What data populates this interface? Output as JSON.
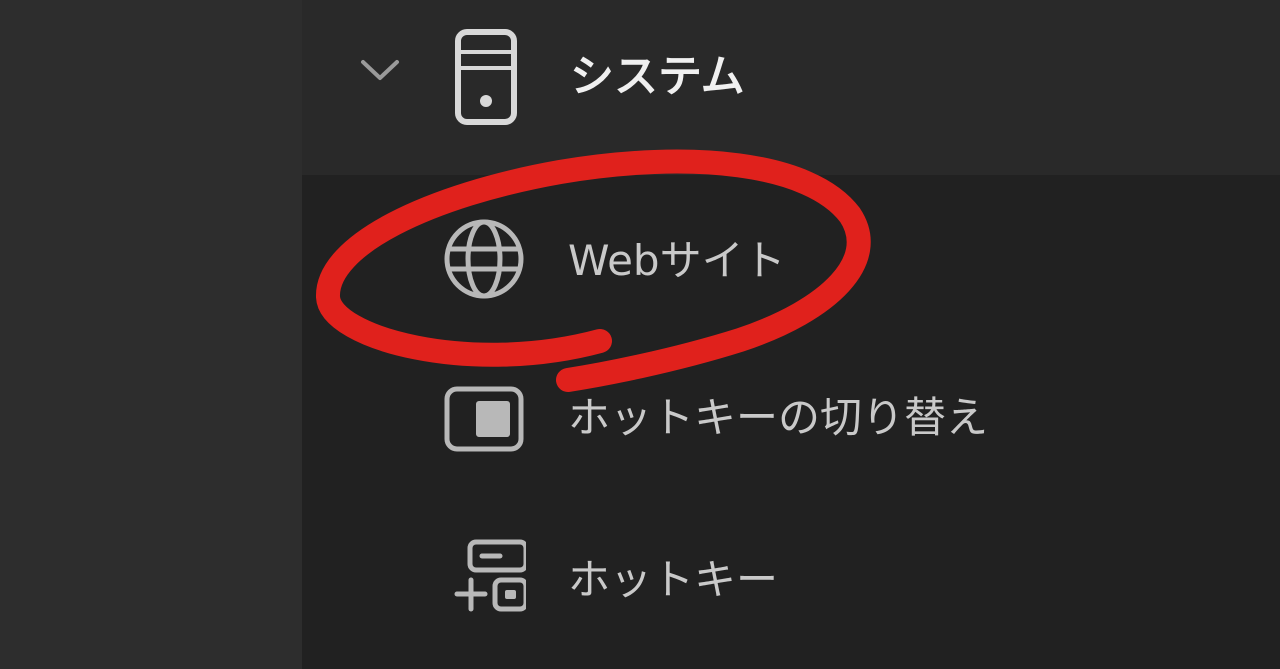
{
  "group": {
    "label": "システム",
    "icon": "desktop-tower-icon",
    "expanded": true
  },
  "items": [
    {
      "label": "Webサイト",
      "icon": "globe-icon"
    },
    {
      "label": "ホットキーの切り替え",
      "icon": "toggle-window-icon"
    },
    {
      "label": "ホットキー",
      "icon": "hotkey-add-icon"
    }
  ],
  "colors": {
    "text": "#c9c9c9",
    "header_text": "#f0f0f0",
    "annotation": "#e0211c"
  }
}
